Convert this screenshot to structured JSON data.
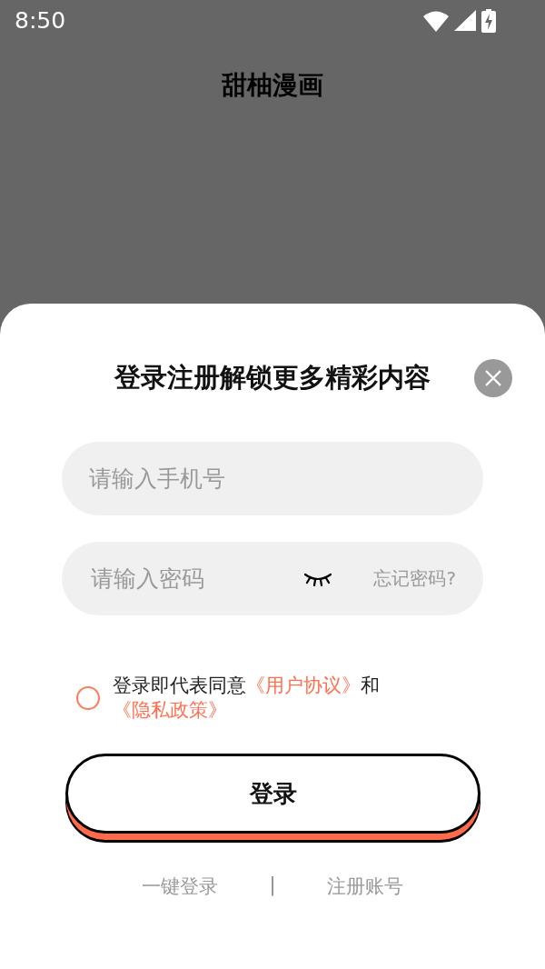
{
  "status_bar": {
    "time": "8:50"
  },
  "app_title": "甜柚漫画",
  "login_sheet": {
    "title": "登录注册解锁更多精彩内容",
    "phone_field": {
      "placeholder": "请输入手机号"
    },
    "password_field": {
      "placeholder": "请输入密码",
      "password_visible": false
    },
    "forgot_password": "忘记密码?",
    "agreement": {
      "checked": false,
      "parts": [
        {
          "kind": "text",
          "text": "登录即代表同意"
        },
        {
          "kind": "link",
          "text": "《用户协议》"
        },
        {
          "kind": "text",
          "text": "和"
        },
        {
          "kind": "link",
          "text": "《隐私政策》"
        }
      ]
    },
    "login_button": "登录",
    "bottom_links": [
      {
        "kind": "link",
        "text": "一键登录"
      },
      {
        "kind": "separator",
        "text": "|"
      },
      {
        "kind": "link",
        "text": "注册账号"
      }
    ]
  }
}
